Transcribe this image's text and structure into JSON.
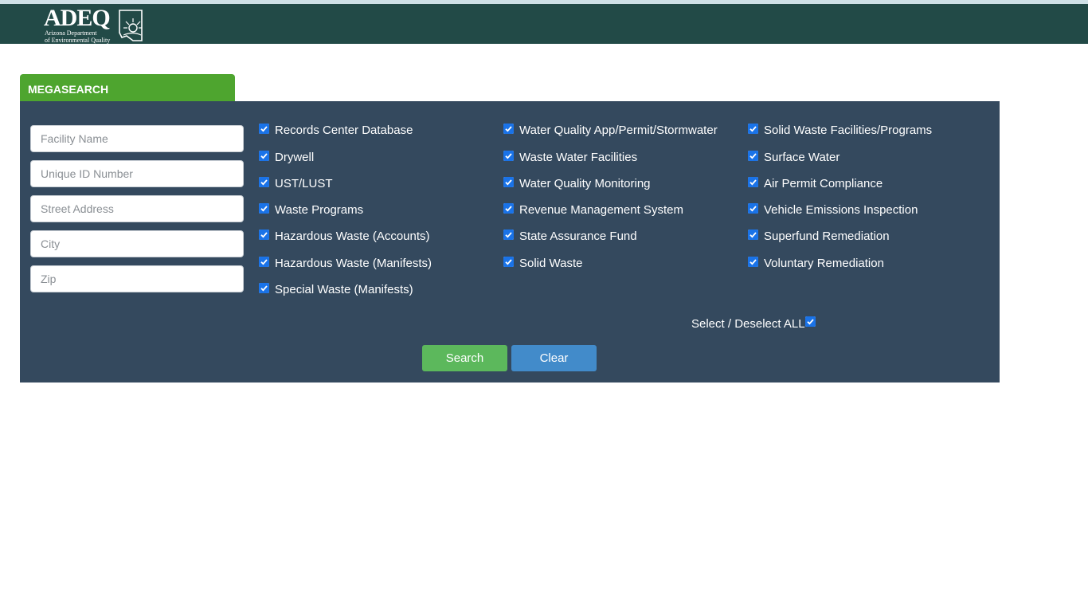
{
  "header": {
    "logo_text": "ADEQ",
    "logo_sub_line1": "Arizona Department",
    "logo_sub_line2": "of Environmental Quality",
    "bg_color": "#224a47"
  },
  "tab": {
    "label": "MEGASEARCH",
    "color": "#4ea52f"
  },
  "panel": {
    "bg_color": "#34495e"
  },
  "fields": {
    "facility_name": {
      "placeholder": "Facility Name",
      "value": ""
    },
    "unique_id": {
      "placeholder": "Unique ID Number",
      "value": ""
    },
    "street_address": {
      "placeholder": "Street Address",
      "value": ""
    },
    "city": {
      "placeholder": "City",
      "value": ""
    },
    "zip": {
      "placeholder": "Zip",
      "value": ""
    }
  },
  "checkboxes": {
    "col1": [
      {
        "label": "Records Center Database",
        "checked": true
      },
      {
        "label": "Drywell",
        "checked": true
      },
      {
        "label": "UST/LUST",
        "checked": true
      },
      {
        "label": "Waste Programs",
        "checked": true
      },
      {
        "label": "Hazardous Waste (Accounts)",
        "checked": true
      },
      {
        "label": "Hazardous Waste (Manifests)",
        "checked": true
      },
      {
        "label": "Special Waste (Manifests)",
        "checked": true
      }
    ],
    "col2": [
      {
        "label": "Water Quality App/Permit/Stormwater",
        "checked": true
      },
      {
        "label": "Waste Water Facilities",
        "checked": true
      },
      {
        "label": "Water Quality Monitoring",
        "checked": true
      },
      {
        "label": "Revenue Management System",
        "checked": true
      },
      {
        "label": "State Assurance Fund",
        "checked": true
      },
      {
        "label": "Solid Waste",
        "checked": true
      }
    ],
    "col3": [
      {
        "label": "Solid Waste Facilities/Programs",
        "checked": true
      },
      {
        "label": "Surface Water",
        "checked": true
      },
      {
        "label": "Air Permit Compliance",
        "checked": true
      },
      {
        "label": "Vehicle Emissions Inspection",
        "checked": true
      },
      {
        "label": "Superfund Remediation",
        "checked": true
      },
      {
        "label": "Voluntary Remediation",
        "checked": true
      }
    ]
  },
  "select_all": {
    "label": "Select / Deselect ALL",
    "checked": true
  },
  "buttons": {
    "search_label": "Search",
    "clear_label": "Clear",
    "search_color": "#5cb85c",
    "clear_color": "#428bca"
  }
}
